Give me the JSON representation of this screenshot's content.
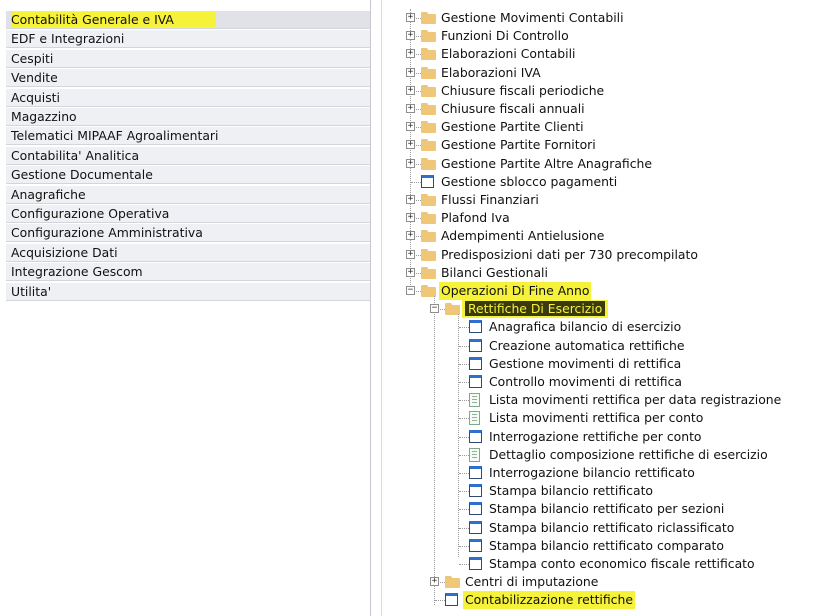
{
  "menu": {
    "items": [
      {
        "label": "Contabilità Generale e IVA",
        "active": true
      },
      {
        "label": "EDF e Integrazioni"
      },
      {
        "label": "Cespiti"
      },
      {
        "label": "Vendite"
      },
      {
        "label": "Acquisti"
      },
      {
        "label": "Magazzino"
      },
      {
        "label": "Telematici MIPAAF Agroalimentari"
      },
      {
        "label": "Contabilita' Analitica"
      },
      {
        "label": "Gestione Documentale"
      },
      {
        "label": "Anagrafiche"
      },
      {
        "label": "Configurazione Operativa"
      },
      {
        "label": "Configurazione Amministrativa"
      },
      {
        "label": "Acquisizione Dati"
      },
      {
        "label": "Integrazione Gescom"
      },
      {
        "label": "Utilita'"
      }
    ]
  },
  "tree": {
    "top": [
      {
        "label": "Gestione Movimenti Contabili",
        "icon": "folder-icon",
        "toggle": "+"
      },
      {
        "label": "Funzioni Di Controllo",
        "icon": "folder-icon",
        "toggle": "+"
      },
      {
        "label": "Elaborazioni Contabili",
        "icon": "folder-icon",
        "toggle": "+"
      },
      {
        "label": "Elaborazioni IVA",
        "icon": "folder-icon",
        "toggle": "+"
      },
      {
        "label": "Chiusure fiscali periodiche",
        "icon": "folder-icon",
        "toggle": "+"
      },
      {
        "label": "Chiusure fiscali annuali",
        "icon": "folder-icon",
        "toggle": "+"
      },
      {
        "label": "Gestione Partite Clienti",
        "icon": "folder-icon",
        "toggle": "+"
      },
      {
        "label": "Gestione Partite Fornitori",
        "icon": "folder-icon",
        "toggle": "+"
      },
      {
        "label": "Gestione Partite Altre Anagrafiche",
        "icon": "folder-icon",
        "toggle": "+"
      },
      {
        "label": "Gestione sblocco pagamenti",
        "icon": "document-icon",
        "toggle": ""
      },
      {
        "label": "Flussi Finanziari",
        "icon": "folder-icon",
        "toggle": "+"
      },
      {
        "label": "Plafond Iva",
        "icon": "folder-icon",
        "toggle": "+"
      },
      {
        "label": "Adempimenti Antielusione",
        "icon": "folder-icon",
        "toggle": "+"
      },
      {
        "label": "Predisposizioni dati per 730 precompilato",
        "icon": "folder-icon",
        "toggle": "+"
      },
      {
        "label": "Bilanci Gestionali",
        "icon": "folder-icon",
        "toggle": "+"
      },
      {
        "label": "Operazioni Di Fine Anno",
        "icon": "folder-icon",
        "toggle": "−",
        "highlight": true
      }
    ],
    "sub_folder": {
      "label": "Rettifiche Di Esercizio",
      "icon": "folder-icon",
      "toggle": "−",
      "highlight": true
    },
    "leaves": [
      {
        "label": "Anagrafica bilancio di esercizio",
        "icon": "document-icon"
      },
      {
        "label": "Creazione automatica rettifiche",
        "icon": "document-icon"
      },
      {
        "label": "Gestione movimenti di rettifica",
        "icon": "document-icon"
      },
      {
        "label": "Controllo movimenti di rettifica",
        "icon": "document-icon"
      },
      {
        "label": "Lista movimenti rettifica per data registrazione",
        "icon": "report-list-icon"
      },
      {
        "label": "Lista movimenti rettifica per conto",
        "icon": "report-list-icon"
      },
      {
        "label": "Interrogazione rettifiche per conto",
        "icon": "document-icon"
      },
      {
        "label": "Dettaglio composizione rettifiche di esercizio",
        "icon": "report-list-icon"
      },
      {
        "label": "Interrogazione bilancio rettificato",
        "icon": "document-icon"
      },
      {
        "label": "Stampa bilancio rettificato",
        "icon": "document-icon"
      },
      {
        "label": "Stampa bilancio rettificato per sezioni",
        "icon": "document-icon"
      },
      {
        "label": "Stampa bilancio rettificato riclassificato",
        "icon": "document-icon"
      },
      {
        "label": "Stampa bilancio rettificato comparato",
        "icon": "document-icon"
      },
      {
        "label": "Stampa conto economico fiscale rettificato",
        "icon": "document-icon"
      }
    ],
    "after": [
      {
        "label": "Centri di imputazione",
        "icon": "folder-icon",
        "toggle": "+"
      },
      {
        "label": "Contabilizzazione rettifiche",
        "icon": "document-icon",
        "toggle": "",
        "highlight": true
      }
    ]
  },
  "colors": {
    "highlight": "#f6f23a",
    "menu_bg": "#eff0f4",
    "folder": "#f0c778",
    "doc_header": "#2f6fd0"
  }
}
